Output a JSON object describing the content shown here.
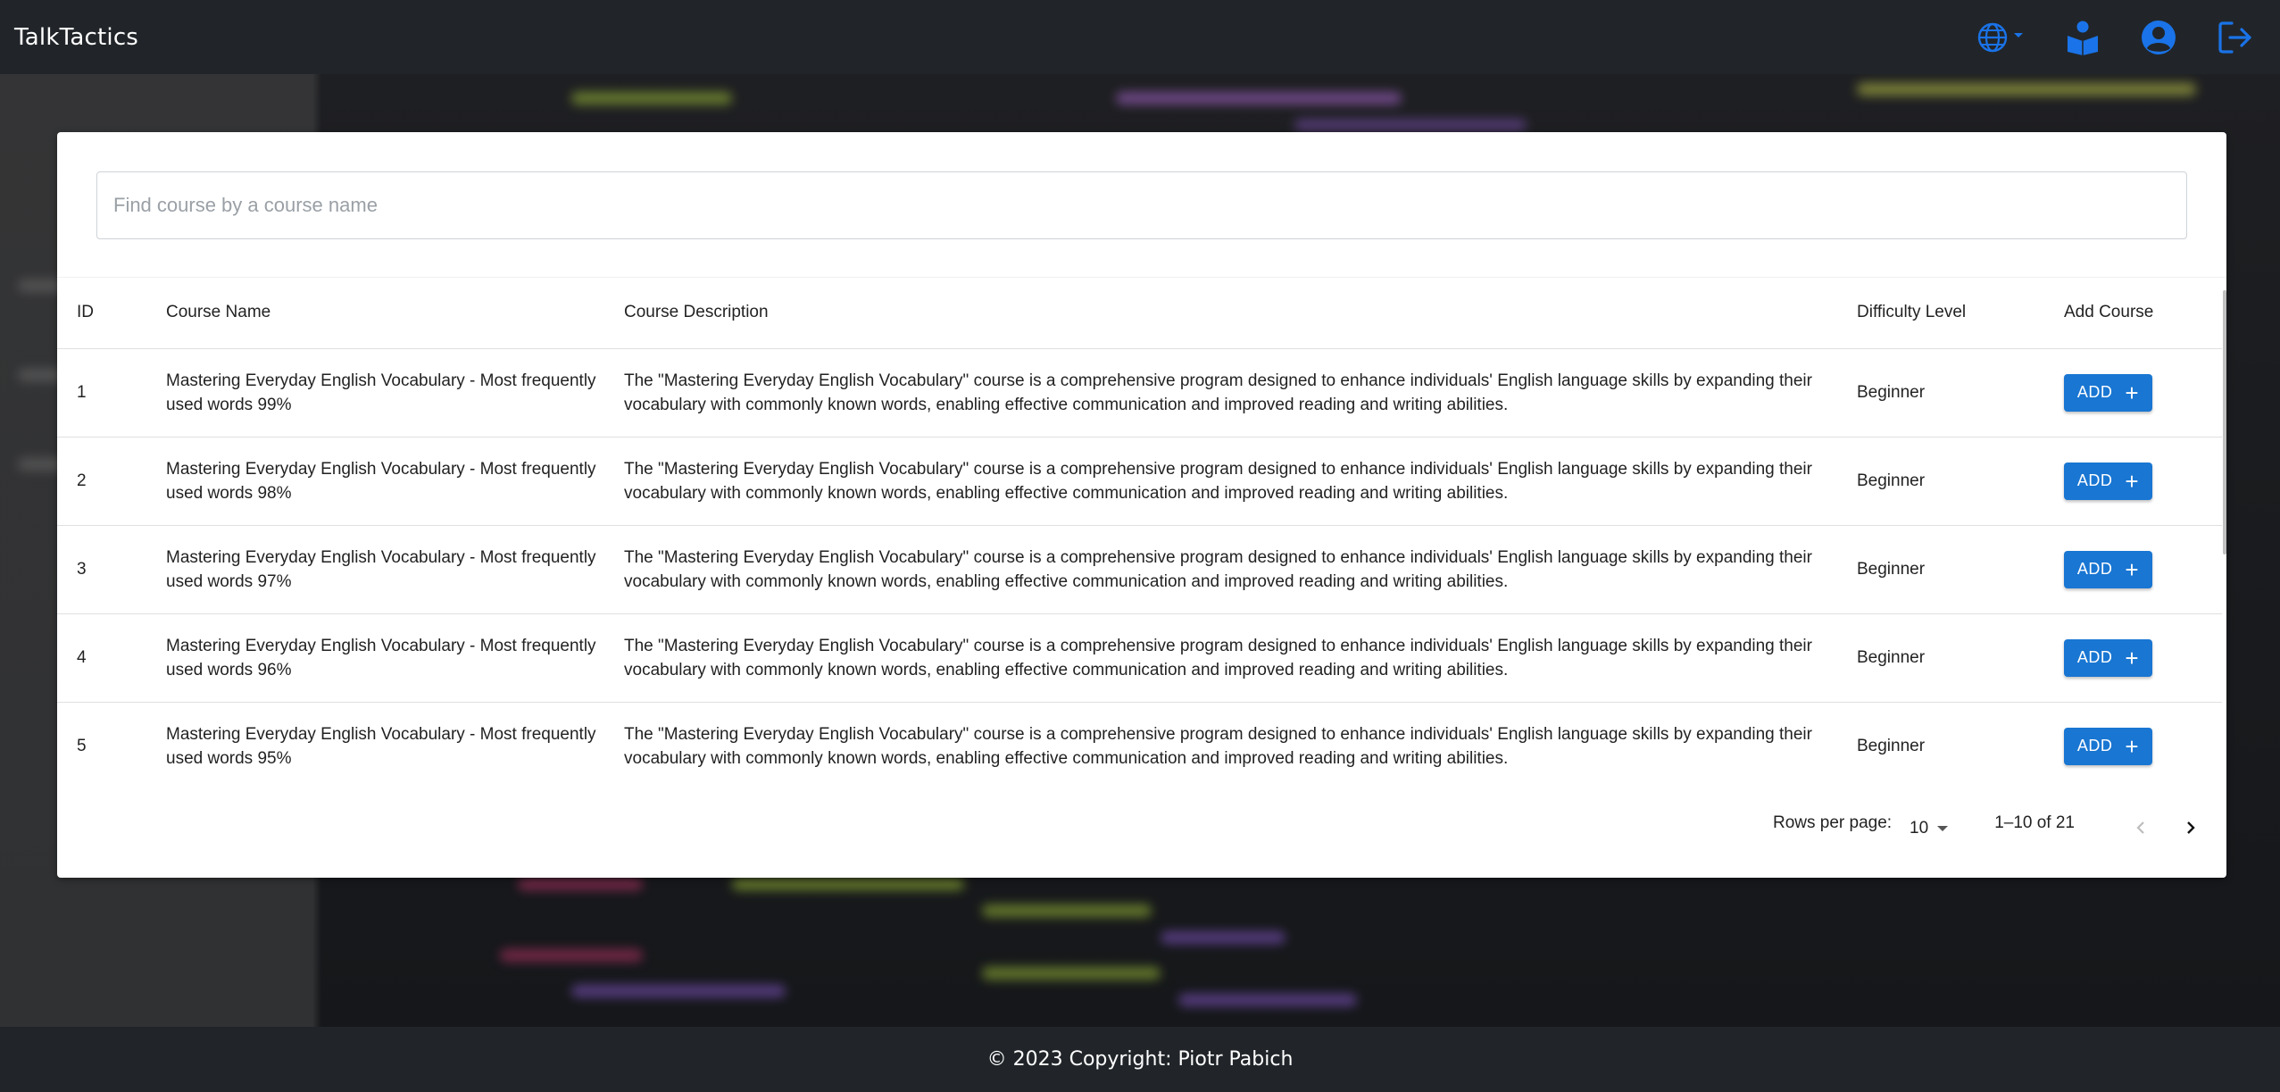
{
  "app": {
    "title": "TalkTactics"
  },
  "navbar": {
    "icons": [
      "globe-icon",
      "book-reader-icon",
      "user-circle-icon",
      "logout-icon"
    ],
    "accent_color": "#1a73e8"
  },
  "search": {
    "placeholder": "Find course by a course name",
    "value": ""
  },
  "table": {
    "headers": [
      "ID",
      "Course Name",
      "Course Description",
      "Difficulty Level",
      "Add Course"
    ],
    "rows": [
      {
        "id": "1",
        "name": "Mastering Everyday English Vocabulary - Most frequently used words 99%",
        "description": "The \"Mastering Everyday English Vocabulary\" course is a comprehensive program designed to enhance individuals' English language skills by expanding their vocabulary with commonly known words, enabling effective communication and improved reading and writing abilities.",
        "level": "Beginner",
        "button": "ADD"
      },
      {
        "id": "2",
        "name": "Mastering Everyday English Vocabulary - Most frequently used words 98%",
        "description": "The \"Mastering Everyday English Vocabulary\" course is a comprehensive program designed to enhance individuals' English language skills by expanding their vocabulary with commonly known words, enabling effective communication and improved reading and writing abilities.",
        "level": "Beginner",
        "button": "ADD"
      },
      {
        "id": "3",
        "name": "Mastering Everyday English Vocabulary - Most frequently used words 97%",
        "description": "The \"Mastering Everyday English Vocabulary\" course is a comprehensive program designed to enhance individuals' English language skills by expanding their vocabulary with commonly known words, enabling effective communication and improved reading and writing abilities.",
        "level": "Beginner",
        "button": "ADD"
      },
      {
        "id": "4",
        "name": "Mastering Everyday English Vocabulary - Most frequently used words 96%",
        "description": "The \"Mastering Everyday English Vocabulary\" course is a comprehensive program designed to enhance individuals' English language skills by expanding their vocabulary with commonly known words, enabling effective communication and improved reading and writing abilities.",
        "level": "Beginner",
        "button": "ADD"
      },
      {
        "id": "5",
        "name": "Mastering Everyday English Vocabulary - Most frequently used words 95%",
        "description": "The \"Mastering Everyday English Vocabulary\" course is a comprehensive program designed to enhance individuals' English language skills by expanding their vocabulary with commonly known words, enabling effective communication and improved reading and writing abilities.",
        "level": "Beginner",
        "button": "ADD"
      }
    ],
    "button_color": "#1976d2"
  },
  "pagination": {
    "rows_per_page_label": "Rows per page:",
    "rows_per_page_value": "10",
    "range": "1–10 of 21"
  },
  "footer": {
    "text": "© 2023 Copyright: Piotr Pabich"
  }
}
